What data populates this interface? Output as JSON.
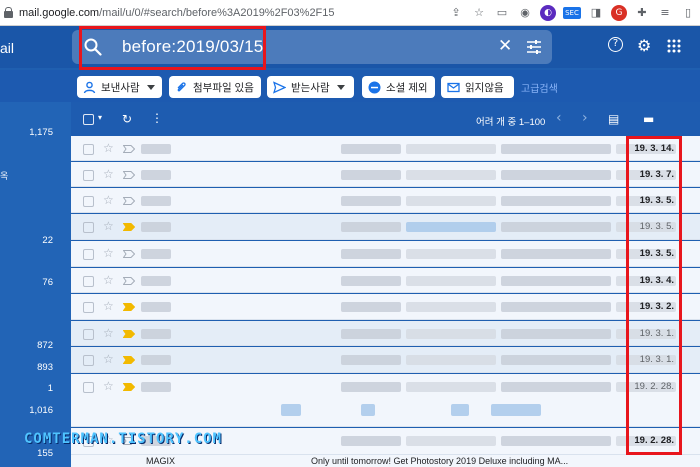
{
  "browser": {
    "url_host": "mail.google.com",
    "url_path": "/mail/u/0/#search/before%3A2019%2F03%2F15",
    "extensions": [
      "share-icon",
      "star-icon",
      "cast-icon",
      "shield-icon",
      "ext-dark-icon",
      "sec-icon",
      "media-icon",
      "red-icon",
      "puzzle-icon",
      "music-icon",
      "sidebar-icon"
    ],
    "sec_label": "SEC"
  },
  "gmail": {
    "brand": "ail",
    "search_query": "before:2019/03/15",
    "close_glyph": "✕",
    "help_glyph": "?",
    "settings_glyph": "⚙",
    "apps_glyph": "⋮⋮⋮"
  },
  "chips": [
    {
      "label": "보낸사람",
      "icon": "person-icon",
      "dropdown": true
    },
    {
      "label": "첨부파일 있음",
      "icon": "attachment-icon",
      "dropdown": false
    },
    {
      "label": "받는사람",
      "icon": "send-icon",
      "dropdown": true
    },
    {
      "label": "소셜 제외",
      "icon": "minus-icon",
      "dropdown": false
    },
    {
      "label": "읽지않음",
      "icon": "mail-icon",
      "dropdown": false
    }
  ],
  "advanced_search": "고급검색",
  "toolbar": {
    "pagination": "어려 개 중 1–100",
    "prev_glyph": "‹",
    "next_glyph": "›"
  },
  "sidebar": {
    "counts": [
      "1,175",
      "22",
      "76",
      "872",
      "893",
      "1",
      "1,016",
      "155"
    ],
    "partial": "옥"
  },
  "emails": [
    {
      "date": "19. 3. 14.",
      "bold": true,
      "important": false
    },
    {
      "date": "19. 3. 7.",
      "bold": true,
      "important": false
    },
    {
      "date": "19. 3. 5.",
      "bold": true,
      "important": false
    },
    {
      "date": "19. 3. 5.",
      "bold": false,
      "important": true
    },
    {
      "date": "19. 3. 5.",
      "bold": true,
      "important": false
    },
    {
      "date": "19. 3. 4.",
      "bold": true,
      "important": false
    },
    {
      "date": "19. 3. 2.",
      "bold": true,
      "important": true
    },
    {
      "date": "19. 3. 1.",
      "bold": false,
      "important": true
    },
    {
      "date": "19. 3. 1.",
      "bold": false,
      "important": true
    },
    {
      "date": "19. 2. 28.",
      "bold": false,
      "important": true
    },
    {
      "date": "19. 2. 28.",
      "bold": true,
      "important": false
    }
  ],
  "bottom_row": {
    "sender": "MAGIX",
    "subject": "Only until tomorrow! Get Photostory 2019 Deluxe including MA...",
    "date": "19. 2. 28."
  },
  "watermark": "COMTERMAN.TISTORY.COM",
  "colors": {
    "highlight": "#e8151c",
    "header_bg": "#1a56a8",
    "important_marker": "#f2b900"
  }
}
